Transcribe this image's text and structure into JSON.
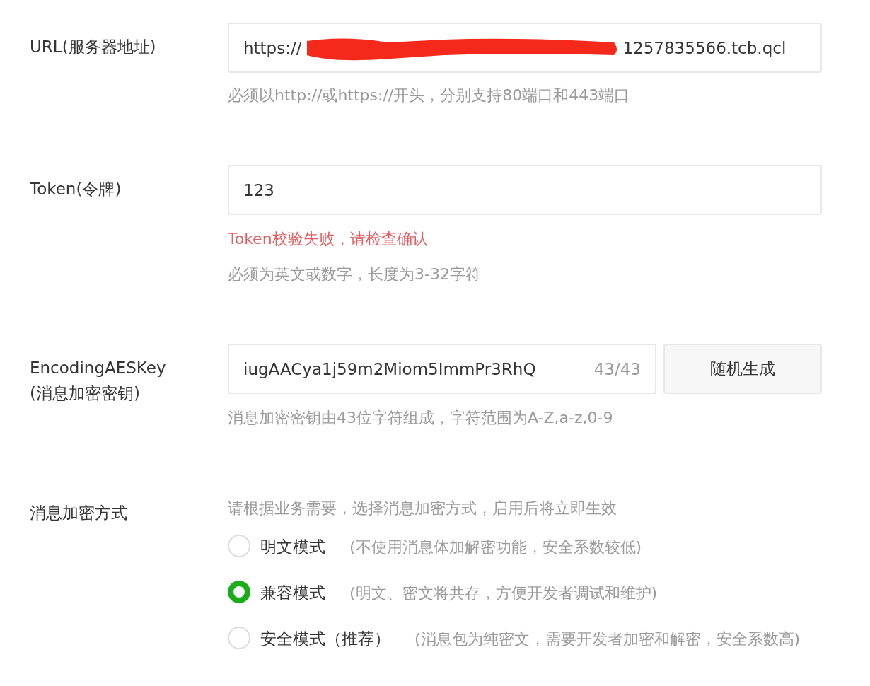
{
  "fields": [
    {
      "kind": "url",
      "label": "URL(服务器地址)",
      "value_start": "https://",
      "value_end": "1257835566.tcb.qcl",
      "hints": [
        {
          "kind": "hint",
          "text": "必须以http://或https://开头，分别支持80端口和443端口"
        }
      ]
    },
    {
      "kind": "text",
      "label": "Token(令牌)",
      "value": "123",
      "hints": [
        {
          "kind": "error",
          "text": "Token校验失败，请检查确认"
        },
        {
          "kind": "hint",
          "text": "必须为英文或数字，长度为3-32字符"
        }
      ]
    },
    {
      "kind": "key",
      "label": "EncodingAESKey",
      "label_sub": "(消息加密密钥)",
      "value": "iugAACya1j59m2Miom5ImmPr3RhQ",
      "counter": "43/43",
      "button": "随机生成",
      "hints": [
        {
          "kind": "hint",
          "text": "消息加密密钥由43位字符组成，字符范围为A-Z,a-z,0-9"
        }
      ]
    }
  ],
  "encryption": {
    "label": "消息加密方式",
    "intro": "请根据业务需要，选择消息加密方式，启用后将立即生效",
    "options": [
      {
        "label": "明文模式",
        "description": "(不使用消息体加解密功能，安全系数较低)",
        "selected": false
      },
      {
        "label": "兼容模式",
        "description": "(明文、密文将共存，方便开发者调试和维护)",
        "selected": true
      },
      {
        "label": "安全模式（推荐）",
        "description": "(消息包为纯密文，需要开发者加密和解密，安全系数高)",
        "selected": false
      }
    ]
  }
}
